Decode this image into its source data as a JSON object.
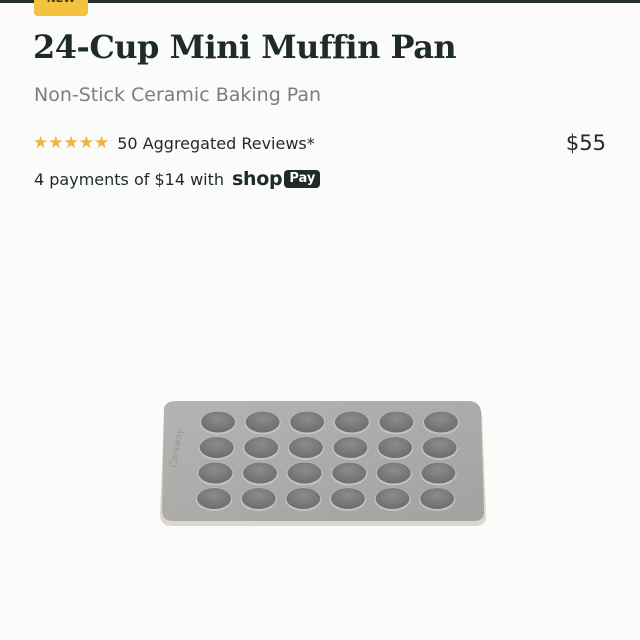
{
  "badge": {
    "label": "NEW"
  },
  "product": {
    "title": "24-Cup Mini Muffin Pan",
    "subtitle": "Non-Stick Ceramic Baking Pan",
    "rating": {
      "stars": 5,
      "max": 5,
      "reviews_text": "50 Aggregated Reviews*"
    },
    "price": "$55",
    "installments": {
      "text": "4 payments of $14 with",
      "provider": "shop",
      "provider_badge": "Pay"
    },
    "image": {
      "alt": "24-cup mini muffin pan",
      "engraving": "Caraway",
      "cups_rows": 4,
      "cups_cols": 6
    }
  },
  "colors": {
    "background": "#fbfbf9",
    "badge": "#f3c33f",
    "star": "#f2b43a",
    "text": "#1e2b27",
    "subtext": "#7b7f7c",
    "pan": "#a9a9a7"
  }
}
